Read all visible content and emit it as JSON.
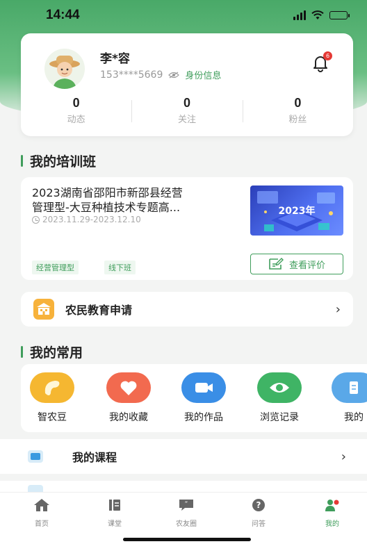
{
  "status_bar": {
    "time": "14:44"
  },
  "profile": {
    "name": "李*容",
    "phone": "153****5669",
    "id_info_label": "身份信息",
    "notification_count": "6",
    "stats": [
      {
        "value": "0",
        "label": "动态"
      },
      {
        "value": "0",
        "label": "关注"
      },
      {
        "value": "0",
        "label": "粉丝"
      }
    ]
  },
  "training_section": {
    "title": "我的培训班",
    "course": {
      "title_line1": "2023湖南省邵阳市新邵县经营",
      "title_line2": "管理型-大豆种植技术专题高...",
      "date_range": "2023.11.29-2023.12.10",
      "thumbnail_text": "2023年",
      "tags": [
        "经营管理型",
        "线下班"
      ],
      "review_button_label": "查看评价"
    }
  },
  "education_application": {
    "label": "农民教育申请"
  },
  "common_section": {
    "title": "我的常用",
    "items": [
      {
        "label": "智农豆",
        "icon": "bean-icon",
        "color": "#f5b731"
      },
      {
        "label": "我的收藏",
        "icon": "heart-icon",
        "color": "#f26a4f"
      },
      {
        "label": "我的作品",
        "icon": "video-camera-icon",
        "color": "#3a8ee6"
      },
      {
        "label": "浏览记录",
        "icon": "eye-icon",
        "color": "#3fb465"
      },
      {
        "label": "我的",
        "icon": "document-icon",
        "color": "#5aa8e8"
      }
    ]
  },
  "list": {
    "my_courses_label": "我的课程"
  },
  "tabbar": {
    "items": [
      {
        "label": "首页",
        "icon": "home-icon"
      },
      {
        "label": "课堂",
        "icon": "classroom-icon"
      },
      {
        "label": "农友圈",
        "icon": "chat-icon"
      },
      {
        "label": "问答",
        "icon": "question-icon"
      },
      {
        "label": "我的",
        "icon": "profile-icon"
      }
    ],
    "active_index": 4
  },
  "colors": {
    "brand_green": "#3f9d5b",
    "header_green": "#49a968",
    "alert_red": "#e53935"
  }
}
